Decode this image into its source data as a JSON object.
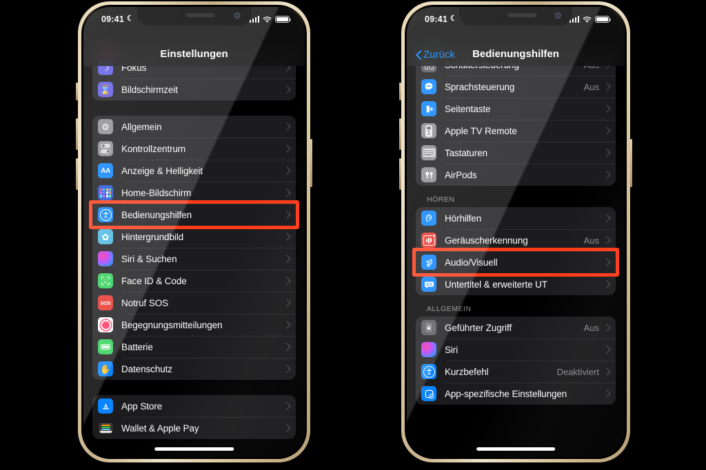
{
  "meta": {
    "accent_highlight": "#ff3b18",
    "ios_blue": "#0a84ff",
    "group_bg": "#1c1c1e",
    "value_gray": "#8e8e93"
  },
  "left_phone": {
    "status": {
      "time": "09:41",
      "moon": "☾"
    },
    "nav": {
      "title": "Einstellungen"
    },
    "group_a": [
      {
        "label": "Fokus",
        "icon": "focus-moon-icon",
        "icon_bg": "#5e5ce6",
        "glyph": "☽",
        "value": ""
      },
      {
        "label": "Bildschirmzeit",
        "icon": "hourglass-icon",
        "icon_bg": "#5e5ce6",
        "glyph": "⌛",
        "value": ""
      }
    ],
    "group_b": [
      {
        "label": "Allgemein",
        "icon": "gear-icon",
        "icon_bg": "#8e8e93",
        "glyph": "⚙",
        "value": ""
      },
      {
        "label": "Kontrollzentrum",
        "icon": "control-center-icon",
        "icon_bg": "#8e8e93",
        "glyph": "toggles",
        "value": ""
      },
      {
        "label": "Anzeige & Helligkeit",
        "icon": "display-brightness-icon",
        "icon_bg": "#0a84ff",
        "glyph": "AA",
        "value": ""
      },
      {
        "label": "Home-Bildschirm",
        "icon": "home-screen-icon",
        "icon_bg": "#2451d8",
        "glyph": "dots",
        "value": ""
      },
      {
        "label": "Bedienungshilfen",
        "icon": "accessibility-icon",
        "icon_bg": "#0a84ff",
        "glyph": "accessibility",
        "value": ""
      },
      {
        "label": "Hintergrundbild",
        "icon": "wallpaper-icon",
        "icon_bg": "#49b8e0",
        "glyph": "✿",
        "value": ""
      },
      {
        "label": "Siri & Suchen",
        "icon": "siri-icon",
        "icon_bg": "#1a1a2e",
        "glyph": "siri",
        "value": ""
      },
      {
        "label": "Face ID & Code",
        "icon": "face-id-icon",
        "icon_bg": "#30d158",
        "glyph": "faceid",
        "value": ""
      },
      {
        "label": "Notruf SOS",
        "icon": "sos-icon",
        "icon_bg": "#e8342c",
        "glyph": "SOS",
        "value": ""
      },
      {
        "label": "Begegnungsmitteilungen",
        "icon": "exposure-notifications-icon",
        "icon_bg": "#ffffff",
        "glyph": "exposure",
        "value": ""
      },
      {
        "label": "Batterie",
        "icon": "battery-icon",
        "icon_bg": "#30d158",
        "glyph": "battery",
        "value": ""
      },
      {
        "label": "Datenschutz",
        "icon": "privacy-hand-icon",
        "icon_bg": "#0a84ff",
        "glyph": "✋",
        "value": ""
      }
    ],
    "group_c": [
      {
        "label": "App Store",
        "icon": "app-store-icon",
        "icon_bg": "#0a84ff",
        "glyph": "appstore",
        "value": ""
      },
      {
        "label": "Wallet & Apple Pay",
        "icon": "wallet-icon",
        "icon_bg": "#1c1c1e",
        "glyph": "wallet",
        "value": ""
      }
    ],
    "highlight_row": "Bedienungshilfen"
  },
  "right_phone": {
    "status": {
      "time": "09:41",
      "moon": "☾"
    },
    "nav": {
      "back": "Zurück",
      "title": "Bedienungshilfen"
    },
    "group_a": [
      {
        "label": "Schaltersteuerung",
        "icon": "switch-control-icon",
        "icon_bg": "#5a5a5e",
        "glyph": "sq4",
        "value": "Aus"
      },
      {
        "label": "Sprachsteuerung",
        "icon": "voice-control-icon",
        "icon_bg": "#0a84ff",
        "glyph": "voice",
        "value": "Aus"
      },
      {
        "label": "Seitentaste",
        "icon": "side-button-icon",
        "icon_bg": "#0a84ff",
        "glyph": "sidebtn",
        "value": ""
      },
      {
        "label": "Apple TV Remote",
        "icon": "apple-tv-remote-icon",
        "icon_bg": "#8e8e93",
        "glyph": "remote",
        "value": ""
      },
      {
        "label": "Tastaturen",
        "icon": "keyboard-icon",
        "icon_bg": "#8e8e93",
        "glyph": "keyboard",
        "value": ""
      },
      {
        "label": "AirPods",
        "icon": "airpods-icon",
        "icon_bg": "#8e8e93",
        "glyph": "airpods",
        "value": ""
      }
    ],
    "section_hearing": "HÖREN",
    "group_hearing": [
      {
        "label": "Hörhilfen",
        "icon": "hearing-devices-icon",
        "icon_bg": "#0a84ff",
        "glyph": "ear",
        "value": ""
      },
      {
        "label": "Geräuscherkennung",
        "icon": "sound-recognition-icon",
        "icon_bg": "#e8342c",
        "glyph": "soundrec",
        "value": "Aus"
      },
      {
        "label": "Audio/Visuell",
        "icon": "audio-visual-icon",
        "icon_bg": "#0a84ff",
        "glyph": "audiovis",
        "value": ""
      },
      {
        "label": "Untertitel & erweiterte UT",
        "icon": "subtitles-icon",
        "icon_bg": "#0a84ff",
        "glyph": "subtitles",
        "value": ""
      }
    ],
    "section_general": "ALLGEMEIN",
    "group_general": [
      {
        "label": "Geführter Zugriff",
        "icon": "guided-access-lock-icon",
        "icon_bg": "#5a5a5e",
        "glyph": "lock",
        "value": "Aus"
      },
      {
        "label": "Siri",
        "icon": "siri-icon",
        "icon_bg": "#1a1a2e",
        "glyph": "siri",
        "value": ""
      },
      {
        "label": "Kurzbefehl",
        "icon": "accessibility-shortcut-icon",
        "icon_bg": "#0a84ff",
        "glyph": "accessibility",
        "value": "Deaktiviert"
      },
      {
        "label": "App-spezifische Einstellungen",
        "icon": "per-app-settings-icon",
        "icon_bg": "#0a84ff",
        "glyph": "perapp",
        "value": ""
      }
    ],
    "highlight_row": "Audio/Visuell"
  }
}
